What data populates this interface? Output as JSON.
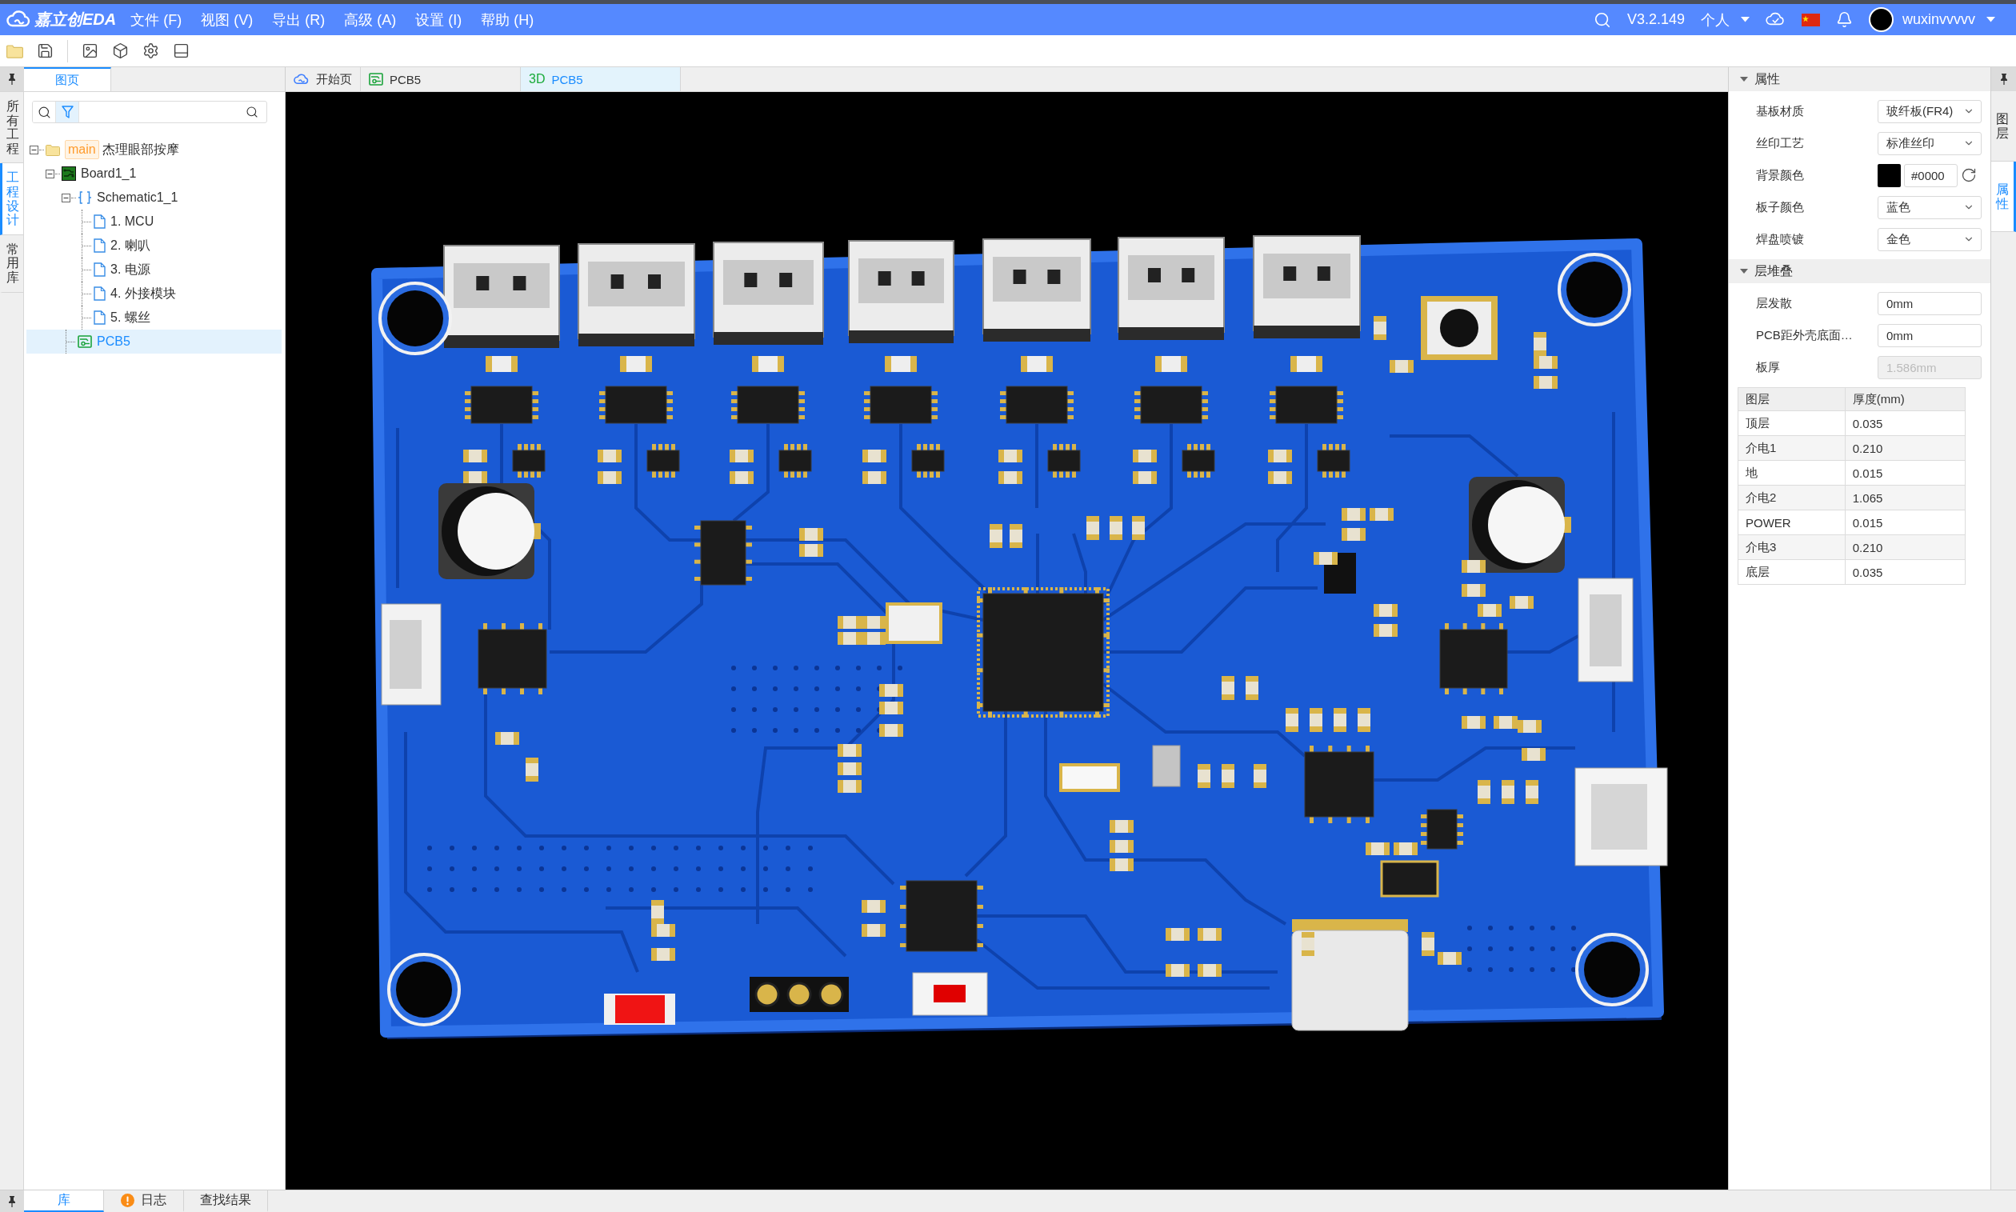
{
  "menu_bar": {
    "logo_text": "嘉立创EDA",
    "menus": [
      "文件 (F)",
      "视图 (V)",
      "导出 (R)",
      "高级 (A)",
      "设置 (I)",
      "帮助 (H)"
    ],
    "version": "V3.2.149",
    "workspace": "个人",
    "username": "wuxinvvvvv"
  },
  "left_panel": {
    "header_tabs": [
      {
        "label": "图页",
        "selected": true
      }
    ],
    "side_tabs": [
      {
        "label": "所有工程",
        "selected": false
      },
      {
        "label": "工程设计",
        "selected": true
      },
      {
        "label": "常用库",
        "selected": false
      }
    ],
    "tree": [
      {
        "kind": "project",
        "tag": "main",
        "label": "杰理眼部按摩",
        "expanded": true,
        "selected": false,
        "children": [
          {
            "kind": "board",
            "label": "Board1_1",
            "expanded": true,
            "selected": false,
            "children": [
              {
                "kind": "schematic",
                "label": "Schematic1_1",
                "expanded": true,
                "selected": false,
                "children": [
                  {
                    "kind": "page",
                    "label": "1. MCU",
                    "selected": false
                  },
                  {
                    "kind": "page",
                    "label": "2. 喇叭",
                    "selected": false
                  },
                  {
                    "kind": "page",
                    "label": "3. 电源",
                    "selected": false
                  },
                  {
                    "kind": "page",
                    "label": "4. 外接模块",
                    "selected": false
                  },
                  {
                    "kind": "page",
                    "label": "5. 螺丝",
                    "selected": false
                  }
                ]
              },
              {
                "kind": "pcb",
                "label": "PCB5",
                "selected": true
              }
            ]
          }
        ]
      }
    ]
  },
  "document_tabs": [
    {
      "kind": "home",
      "label": "开始页",
      "selected": false
    },
    {
      "kind": "pcb",
      "label": "PCB5",
      "selected": false
    },
    {
      "kind": "viewer",
      "badge": "3D",
      "label": "PCB5",
      "selected": true
    }
  ],
  "properties_panel": {
    "side_tabs": [
      {
        "label": "图层",
        "selected": false
      },
      {
        "label": "属性",
        "selected": true
      }
    ],
    "sections": [
      {
        "title": "属性",
        "expanded": true,
        "fields": [
          {
            "kind": "select",
            "label": "基板材质",
            "value": "玻纤板(FR4)",
            "disabled": false
          },
          {
            "kind": "select",
            "label": "丝印工艺",
            "value": "标准丝印",
            "disabled": false
          },
          {
            "kind": "color",
            "label": "背景颜色",
            "value": "#0000",
            "color": "#000000",
            "disabled": false
          },
          {
            "kind": "select",
            "label": "板子颜色",
            "value": "蓝色",
            "disabled": false
          },
          {
            "kind": "select",
            "label": "焊盘喷镀",
            "value": "金色",
            "disabled": false
          }
        ]
      },
      {
        "title": "层堆叠",
        "expanded": true,
        "fields": [
          {
            "kind": "input",
            "label": "层发散",
            "value": "0mm",
            "disabled": false
          },
          {
            "kind": "input",
            "label": "PCB距外壳底面…",
            "value": "0mm",
            "disabled": false
          },
          {
            "kind": "input",
            "label": "板厚",
            "value": "1.586mm",
            "disabled": true
          }
        ],
        "table": {
          "columns": [
            "图层",
            "厚度(mm)"
          ],
          "rows": [
            [
              "顶层",
              "0.035"
            ],
            [
              "介电1",
              "0.210"
            ],
            [
              "地",
              "0.015"
            ],
            [
              "介电2",
              "1.065"
            ],
            [
              "POWER",
              "0.015"
            ],
            [
              "介电3",
              "0.210"
            ],
            [
              "底层",
              "0.035"
            ]
          ]
        }
      }
    ]
  },
  "bottom_tabs": [
    {
      "label": "库",
      "selected": true,
      "warning": false
    },
    {
      "label": "日志",
      "selected": false,
      "warning": true
    },
    {
      "label": "查找结果",
      "selected": false,
      "warning": false
    }
  ]
}
